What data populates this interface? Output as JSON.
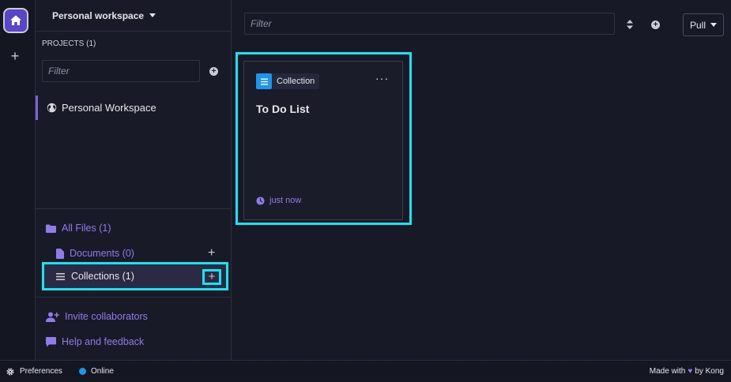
{
  "rail": {
    "home_icon": "home-icon",
    "add_icon": "plus-icon",
    "add_glyph": "+"
  },
  "sidebar": {
    "workspace_name": "Personal workspace",
    "projects_label": "PROJECTS (1)",
    "filter_placeholder": "Filter",
    "project": "Personal Workspace",
    "nav": {
      "all_files": "All Files (1)",
      "documents": "Documents (0)",
      "collections": "Collections (1)"
    },
    "invite": "Invite collaborators",
    "help": "Help and feedback",
    "plus_glyph": "+"
  },
  "main": {
    "filter_placeholder": "Filter",
    "pull_label": "Pull",
    "card": {
      "badge": "Collection",
      "menu": "···",
      "title": "To Do List",
      "time": "just now"
    }
  },
  "statusbar": {
    "preferences": "Preferences",
    "online": "Online",
    "made_with": "Made with",
    "by": "by Kong",
    "heart": "♥"
  },
  "colors": {
    "accent": "#8f7bec",
    "highlight": "#18e3f0",
    "online": "#1a97ea",
    "background": "#171a26"
  }
}
